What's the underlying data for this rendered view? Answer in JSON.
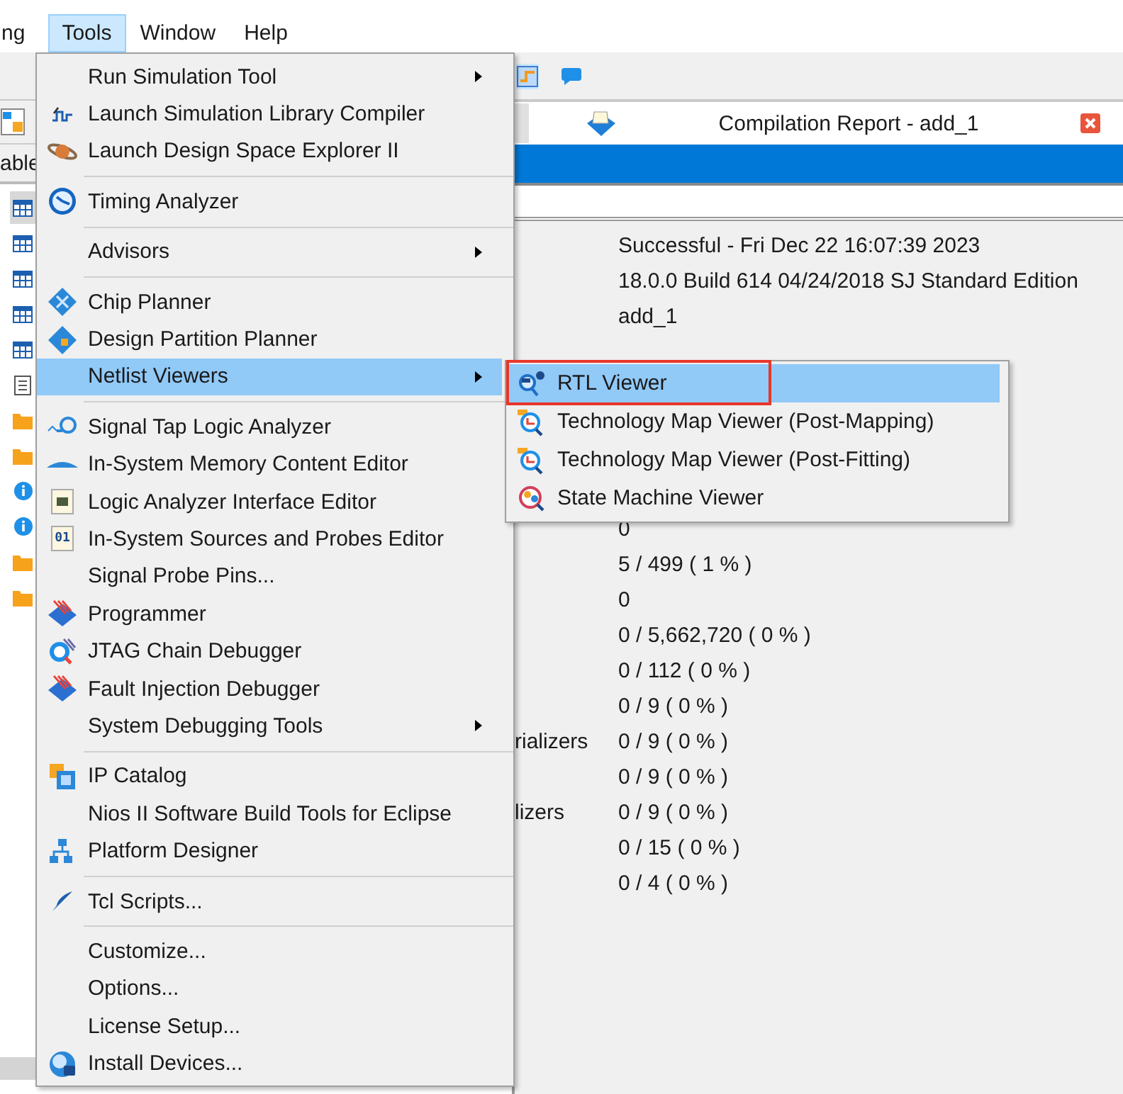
{
  "menubar": [
    {
      "label": "ng",
      "selected": false
    },
    {
      "label": "Tools",
      "selected": true
    },
    {
      "label": "Window",
      "selected": false
    },
    {
      "label": "Help",
      "selected": false
    }
  ],
  "left_panel": {
    "tab": "able",
    "items": [
      {
        "kind": "table",
        "selected": true
      },
      {
        "kind": "table",
        "selected": false
      },
      {
        "kind": "table",
        "selected": false
      },
      {
        "kind": "table",
        "selected": false
      },
      {
        "kind": "table",
        "selected": false
      },
      {
        "kind": "document",
        "selected": false
      },
      {
        "kind": "folder",
        "selected": false
      },
      {
        "kind": "folder",
        "selected": false
      },
      {
        "kind": "info",
        "selected": false
      },
      {
        "kind": "info",
        "selected": false
      },
      {
        "kind": "folder",
        "selected": false
      },
      {
        "kind": "folder",
        "selected": false
      }
    ]
  },
  "report": {
    "title": "Compilation Report - add_1",
    "rows_upper": [
      {
        "value": "Successful - Fri Dec 22 16:07:39 2023"
      },
      {
        "value": "18.0.0 Build 614 04/24/2018 SJ Standard Edition"
      },
      {
        "value": "add_1"
      }
    ],
    "rows_lower": [
      {
        "value": "0"
      },
      {
        "value": "5 / 499 ( 1 % )"
      },
      {
        "value": "0"
      },
      {
        "value": "0 / 5,662,720 ( 0 % )"
      },
      {
        "value": "0 / 112 ( 0 % )"
      },
      {
        "value": "0 / 9 ( 0 % )"
      },
      {
        "label": "rializers",
        "value": "0 / 9 ( 0 % )"
      },
      {
        "value": "0 / 9 ( 0 % )"
      },
      {
        "label": "lizers",
        "value": "0 / 9 ( 0 % )"
      },
      {
        "value": "0 / 15 ( 0 % )"
      },
      {
        "value": "0 / 4 ( 0 % )"
      }
    ]
  },
  "tools_menu": {
    "sections": [
      [
        {
          "label": "Run Simulation Tool",
          "kind": "plain",
          "submenu": true,
          "selected": false
        },
        {
          "label": "Launch Simulation Library Compiler",
          "kind": "wave",
          "submenu": false,
          "selected": false
        },
        {
          "label": "Launch Design Space Explorer II",
          "kind": "planet",
          "submenu": false,
          "selected": false
        }
      ],
      [
        {
          "label": "Timing Analyzer",
          "kind": "clock",
          "submenu": false,
          "selected": false
        }
      ],
      [
        {
          "label": "Advisors",
          "kind": "plain",
          "submenu": true,
          "selected": false
        }
      ],
      [
        {
          "label": "Chip Planner",
          "kind": "diamond",
          "submenu": false,
          "selected": false
        },
        {
          "label": "Design Partition Planner",
          "kind": "partition",
          "submenu": false,
          "selected": false
        },
        {
          "label": "Netlist Viewers",
          "kind": "plain",
          "submenu": true,
          "selected": true
        }
      ],
      [
        {
          "label": "Signal Tap Logic Analyzer",
          "kind": "probe",
          "submenu": false,
          "selected": false
        },
        {
          "label": "In-System Memory Content Editor",
          "kind": "memory",
          "submenu": false,
          "selected": false
        },
        {
          "label": "Logic Analyzer Interface Editor",
          "kind": "chip",
          "submenu": false,
          "selected": false
        },
        {
          "label": "In-System Sources and Probes Editor",
          "kind": "code",
          "icon_text": "01",
          "submenu": false,
          "selected": false
        },
        {
          "label": "Signal Probe Pins...",
          "kind": "plain",
          "submenu": false,
          "selected": false
        },
        {
          "label": "Programmer",
          "kind": "stripes",
          "submenu": false,
          "selected": false
        },
        {
          "label": "JTAG Chain Debugger",
          "kind": "magnifier",
          "submenu": false,
          "selected": false
        },
        {
          "label": "Fault Injection Debugger",
          "kind": "stripes",
          "submenu": false,
          "selected": false
        },
        {
          "label": "System Debugging Tools",
          "kind": "plain",
          "submenu": true,
          "selected": false
        }
      ],
      [
        {
          "label": "IP Catalog",
          "kind": "ip",
          "submenu": false,
          "selected": false
        },
        {
          "label": "Nios II Software Build Tools for Eclipse",
          "kind": "plain",
          "submenu": false,
          "selected": false
        },
        {
          "label": "Platform Designer",
          "kind": "hierarchy",
          "submenu": false,
          "selected": false
        }
      ],
      [
        {
          "label": "Tcl Scripts...",
          "kind": "feather",
          "submenu": false,
          "selected": false
        }
      ],
      [
        {
          "label": "Customize...",
          "kind": "plain",
          "submenu": false,
          "selected": false
        },
        {
          "label": "Options...",
          "kind": "plain",
          "submenu": false,
          "selected": false
        },
        {
          "label": "License Setup...",
          "kind": "plain",
          "submenu": false,
          "selected": false
        },
        {
          "label": "Install Devices...",
          "kind": "globe",
          "submenu": false,
          "selected": false
        }
      ]
    ]
  },
  "netlist_submenu": [
    {
      "label": "RTL Viewer",
      "kind": "rtl",
      "selected": true,
      "annotated": true
    },
    {
      "label": "Technology Map Viewer (Post-Mapping)",
      "kind": "techmap",
      "selected": false,
      "annotated": false
    },
    {
      "label": "Technology Map Viewer (Post-Fitting)",
      "kind": "techmap",
      "selected": false,
      "annotated": false
    },
    {
      "label": "State Machine Viewer",
      "kind": "state",
      "selected": false,
      "annotated": false
    }
  ]
}
